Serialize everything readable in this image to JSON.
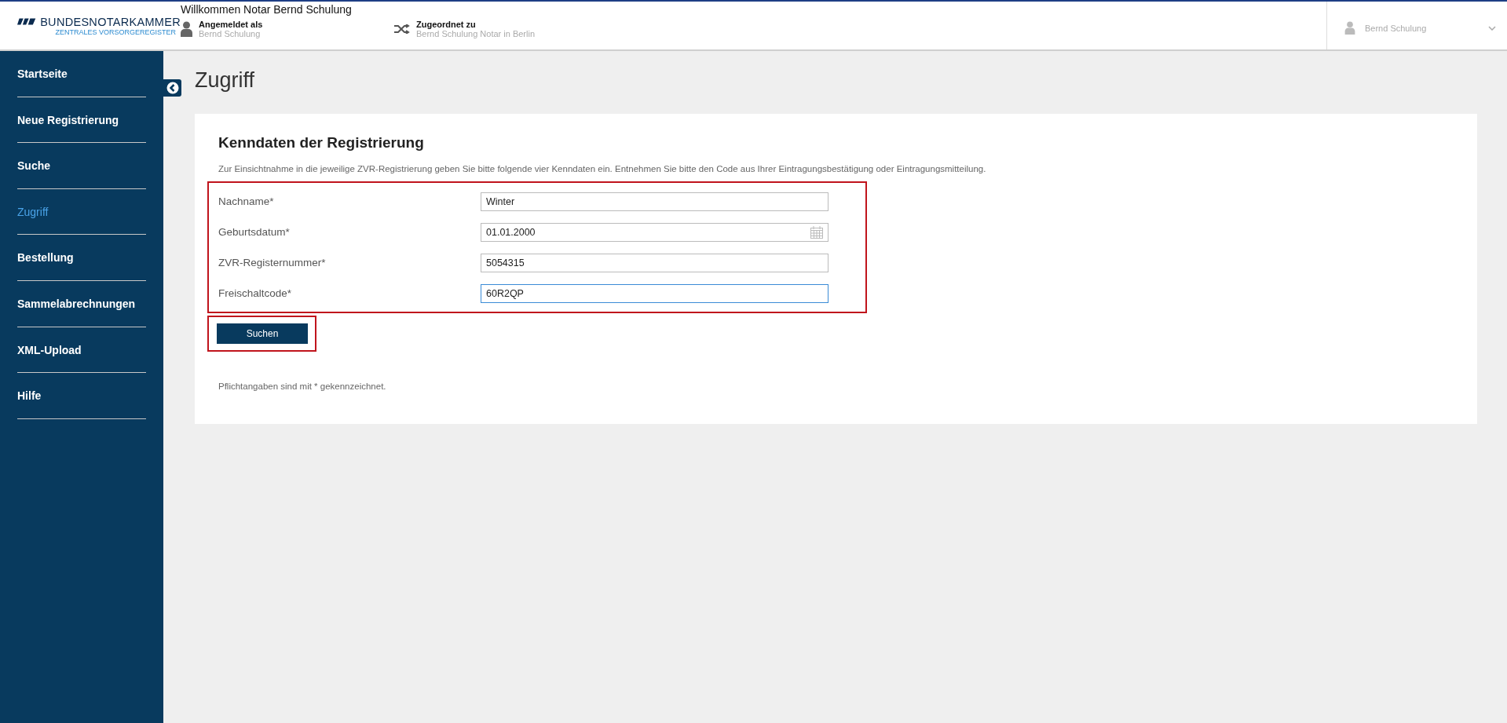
{
  "header": {
    "logo": {
      "name": "BUNDESNOTARKAMMER",
      "subtitle": "ZENTRALES VORSORGEREGISTER"
    },
    "welcome": "Willkommen Notar Bernd Schulung",
    "logged_in": {
      "label": "Angemeldet als",
      "value": "Bernd Schulung"
    },
    "assigned": {
      "label": "Zugeordnet zu",
      "value": "Bernd Schulung Notar in Berlin"
    },
    "user_menu": {
      "name": "Bernd Schulung"
    }
  },
  "sidebar": {
    "items": [
      {
        "label": "Startseite",
        "selected": false
      },
      {
        "label": "Neue Registrierung",
        "selected": false
      },
      {
        "label": "Suche",
        "selected": false
      },
      {
        "label": "Zugriff",
        "selected": true
      },
      {
        "label": "Bestellung",
        "selected": false
      },
      {
        "label": "Sammelabrechnungen",
        "selected": false
      },
      {
        "label": "XML-Upload",
        "selected": false
      },
      {
        "label": "Hilfe",
        "selected": false
      }
    ]
  },
  "page": {
    "title": "Zugriff",
    "card": {
      "heading": "Kenndaten der Registrierung",
      "description": "Zur Einsichtnahme in die jeweilige ZVR-Registrierung geben Sie bitte folgende vier Kenndaten ein. Entnehmen Sie bitte den Code aus Ihrer Eintragungsbestätigung oder Eintragungsmitteilung.",
      "fields": [
        {
          "kind": "text",
          "label": "Nachname*",
          "value": "Winter",
          "focused": false
        },
        {
          "kind": "date",
          "label": "Geburtsdatum*",
          "value": "01.01.2000",
          "focused": false
        },
        {
          "kind": "text",
          "label": "ZVR-Registernummer*",
          "value": "5054315",
          "focused": false
        },
        {
          "kind": "text",
          "label": "Freischaltcode*",
          "value": "60R2QP",
          "focused": true
        }
      ],
      "button": "Suchen",
      "note": "Pflichtangaben sind mit * gekennzeichnet."
    }
  }
}
